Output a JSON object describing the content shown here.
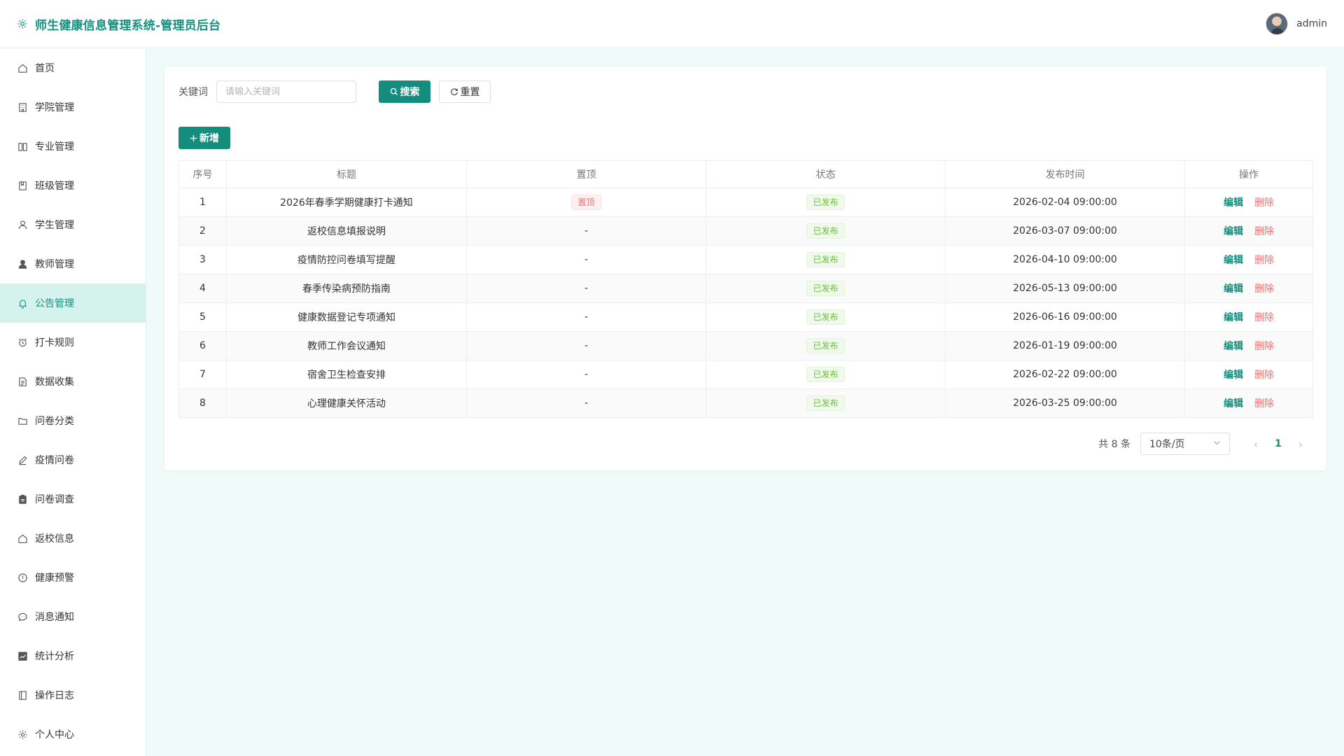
{
  "app": {
    "title": "师生健康信息管理系统-管理员后台",
    "username": "admin"
  },
  "sidebar": {
    "items": [
      {
        "label": "首页",
        "icon": "home-icon"
      },
      {
        "label": "学院管理",
        "icon": "building-icon"
      },
      {
        "label": "专业管理",
        "icon": "book-icon"
      },
      {
        "label": "班级管理",
        "icon": "notebook-icon"
      },
      {
        "label": "学生管理",
        "icon": "user-icon"
      },
      {
        "label": "教师管理",
        "icon": "user-filled-icon"
      },
      {
        "label": "公告管理",
        "icon": "bell-icon",
        "active": true
      },
      {
        "label": "打卡规则",
        "icon": "alarm-clock-icon"
      },
      {
        "label": "数据收集",
        "icon": "document-icon"
      },
      {
        "label": "问卷分类",
        "icon": "folder-icon"
      },
      {
        "label": "疫情问卷",
        "icon": "edit-pen-icon"
      },
      {
        "label": "问卷调查",
        "icon": "clipboard-icon"
      },
      {
        "label": "返校信息",
        "icon": "house-icon"
      },
      {
        "label": "健康预警",
        "icon": "warning-icon"
      },
      {
        "label": "消息通知",
        "icon": "chat-icon"
      },
      {
        "label": "统计分析",
        "icon": "chart-icon"
      },
      {
        "label": "操作日志",
        "icon": "log-book-icon"
      },
      {
        "label": "个人中心",
        "icon": "settings-icon"
      }
    ]
  },
  "search": {
    "label": "关键词",
    "placeholder": "请输入关键词",
    "search_label": "搜索",
    "reset_label": "重置",
    "add_label": "新增"
  },
  "table": {
    "headers": [
      "序号",
      "标题",
      "置顶",
      "状态",
      "发布时间",
      "操作"
    ],
    "rows": [
      {
        "no": "1",
        "title": "2026年春季学期健康打卡通知",
        "pin": "置顶",
        "status": "已发布",
        "time": "2026-02-04 09:00:00"
      },
      {
        "no": "2",
        "title": "返校信息填报说明",
        "pin": "-",
        "status": "已发布",
        "time": "2026-03-07 09:00:00"
      },
      {
        "no": "3",
        "title": "疫情防控问卷填写提醒",
        "pin": "-",
        "status": "已发布",
        "time": "2026-04-10 09:00:00"
      },
      {
        "no": "4",
        "title": "春季传染病预防指南",
        "pin": "-",
        "status": "已发布",
        "time": "2026-05-13 09:00:00"
      },
      {
        "no": "5",
        "title": "健康数据登记专项通知",
        "pin": "-",
        "status": "已发布",
        "time": "2026-06-16 09:00:00"
      },
      {
        "no": "6",
        "title": "教师工作会议通知",
        "pin": "-",
        "status": "已发布",
        "time": "2026-01-19 09:00:00"
      },
      {
        "no": "7",
        "title": "宿舍卫生检查安排",
        "pin": "-",
        "status": "已发布",
        "time": "2026-02-22 09:00:00"
      },
      {
        "no": "8",
        "title": "心理健康关怀活动",
        "pin": "-",
        "status": "已发布",
        "time": "2026-03-25 09:00:00"
      }
    ],
    "edit_label": "编辑",
    "delete_label": "删除"
  },
  "pagination": {
    "total_text": "共 8 条",
    "page_size": "10条/页",
    "current_page": "1"
  },
  "colors": {
    "primary": "#148d7e",
    "danger": "#f56c6c",
    "success": "#67c23a",
    "active_bg": "#d4f3ec"
  }
}
